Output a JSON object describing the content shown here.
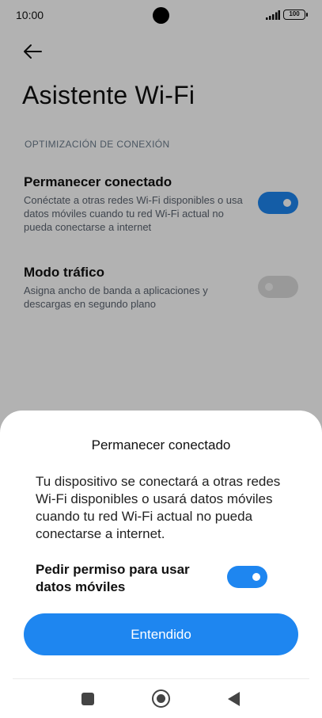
{
  "status": {
    "time": "10:00",
    "battery": "100",
    "signal_icon": "signal-bars-icon"
  },
  "header": {
    "back_icon": "arrow-left-icon",
    "title": "Asistente Wi-Fi"
  },
  "section": {
    "header": "OPTIMIZACIÓN DE CONEXIÓN"
  },
  "settings": [
    {
      "title": "Permanecer conectado",
      "description": "Conéctate a otras redes Wi-Fi disponibles o usa datos móviles cuando tu red Wi-Fi actual no pueda conectarse a internet",
      "enabled": true
    },
    {
      "title": "Modo tráfico",
      "description": "Asigna ancho de banda a aplicaciones y descargas en segundo plano",
      "enabled": false
    }
  ],
  "dialog": {
    "title": "Permanecer conectado",
    "body": "Tu dispositivo se conectará a otras redes Wi-Fi disponibles o usará datos móviles cuando tu red Wi-Fi actual no pueda conectarse a internet.",
    "permission_label": "Pedir permiso para usar datos móviles",
    "permission_enabled": true,
    "button_label": "Entendido"
  },
  "colors": {
    "accent": "#1e86f0",
    "toggle_off": "#dcdcdc"
  },
  "nav": {
    "recents_icon": "square-icon",
    "home_icon": "circle-home-icon",
    "back_icon": "triangle-back-icon"
  }
}
